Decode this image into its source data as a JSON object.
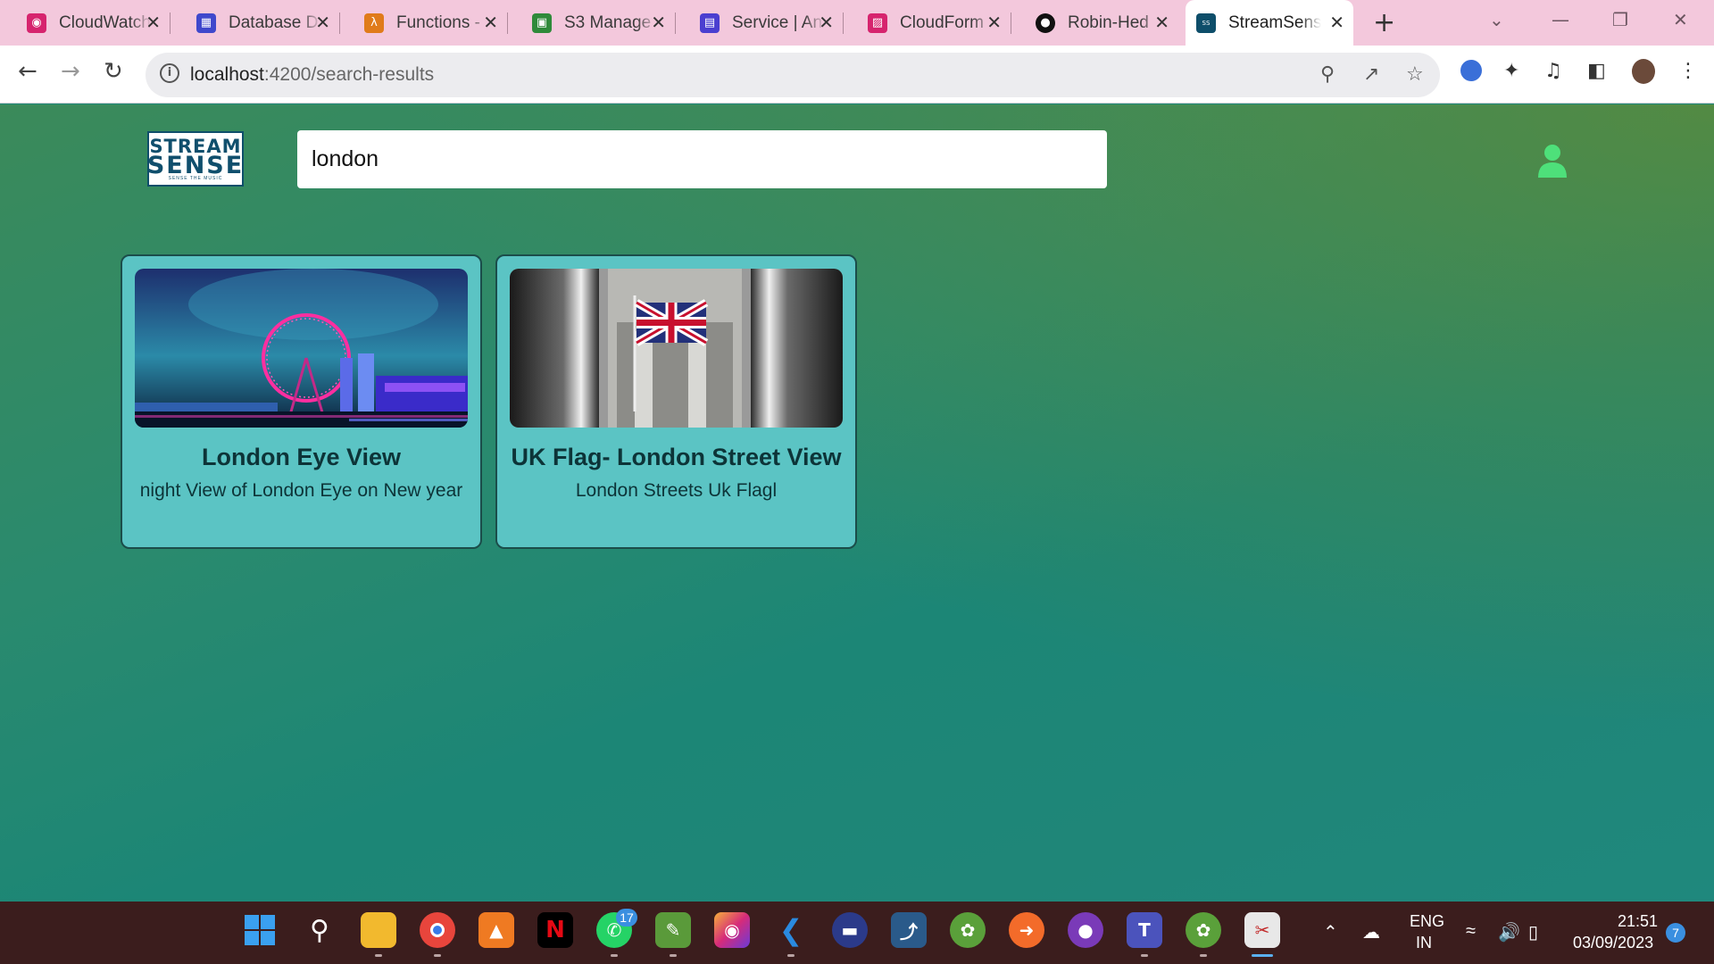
{
  "browser": {
    "tabs": [
      {
        "label": "CloudWatch",
        "icon": "cloudwatch-icon",
        "color": "#d6246e"
      },
      {
        "label": "Database D",
        "icon": "database-icon",
        "color": "#3f48cc"
      },
      {
        "label": "Functions -",
        "icon": "lambda-icon",
        "color": "#e07b1a"
      },
      {
        "label": "S3 Manage",
        "icon": "s3-icon",
        "color": "#2f8a3a"
      },
      {
        "label": "Service | An",
        "icon": "service-icon",
        "color": "#4a3fd0"
      },
      {
        "label": "CloudForm",
        "icon": "cloudformation-icon",
        "color": "#d6246e"
      },
      {
        "label": "Robin-Hed",
        "icon": "github-icon",
        "color": "#111111"
      },
      {
        "label": "StreamSens",
        "icon": "streamsense-icon",
        "color": "#0e4e6a"
      }
    ],
    "url_host": "localhost",
    "url_path": ":4200/search-results"
  },
  "app": {
    "logo_line1": "STREAM",
    "logo_line2": "SENSE",
    "logo_tagline": "SENSE THE MUSIC",
    "search_value": "london",
    "accent": "#4ee07a"
  },
  "results": [
    {
      "title": "London Eye View",
      "description": "night View of London Eye on New year"
    },
    {
      "title": "UK Flag- London Street View",
      "description": "London Streets Uk Flagl"
    }
  ],
  "taskbar": {
    "whatsapp_badge": "17",
    "lang_line1": "ENG",
    "lang_line2": "IN",
    "time": "21:51",
    "date": "03/09/2023",
    "notifications": "7"
  }
}
